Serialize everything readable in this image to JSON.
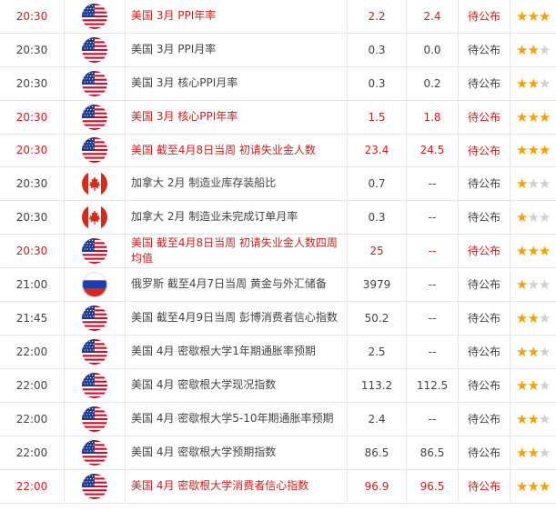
{
  "rows": [
    {
      "time": "20:30",
      "country": "US",
      "event": "美国 3月 PPI年率",
      "prev": "2.2",
      "forecast": "2.4",
      "actual": "待公布",
      "stars": 3,
      "highlight": true
    },
    {
      "time": "20:30",
      "country": "US",
      "event": "美国 3月 PPI月率",
      "prev": "0.3",
      "forecast": "0.0",
      "actual": "待公布",
      "stars": 2,
      "highlight": false
    },
    {
      "time": "20:30",
      "country": "US",
      "event": "美国 3月 核心PPI月率",
      "prev": "0.3",
      "forecast": "0.2",
      "actual": "待公布",
      "stars": 2,
      "highlight": false
    },
    {
      "time": "20:30",
      "country": "US",
      "event": "美国 3月 核心PPI年率",
      "prev": "1.5",
      "forecast": "1.8",
      "actual": "待公布",
      "stars": 3,
      "highlight": true
    },
    {
      "time": "20:30",
      "country": "US",
      "event": "美国 截至4月8日当周 初请失业金人数",
      "prev": "23.4",
      "forecast": "24.5",
      "actual": "待公布",
      "stars": 3,
      "highlight": true
    },
    {
      "time": "20:30",
      "country": "CA",
      "event": "加拿大 2月 制造业库存装船比",
      "prev": "0.7",
      "forecast": "--",
      "actual": "待公布",
      "stars": 1,
      "highlight": false
    },
    {
      "time": "20:30",
      "country": "CA",
      "event": "加拿大 2月 制造业未完成订单月率",
      "prev": "0.3",
      "forecast": "--",
      "actual": "待公布",
      "stars": 1,
      "highlight": false
    },
    {
      "time": "20:30",
      "country": "US",
      "event": "美国 截至4月8日当周 初请失业金人数四周均值",
      "prev": "25",
      "forecast": "--",
      "actual": "待公布",
      "stars": 3,
      "highlight": true
    },
    {
      "time": "21:00",
      "country": "RU",
      "event": "俄罗斯 截至4月7日当周 黄金与外汇储备",
      "prev": "3979",
      "forecast": "--",
      "actual": "待公布",
      "stars": 1,
      "highlight": false
    },
    {
      "time": "21:45",
      "country": "US",
      "event": "美国 截至4月9日当周 彭博消费者信心指数",
      "prev": "50.2",
      "forecast": "--",
      "actual": "待公布",
      "stars": 2,
      "highlight": false
    },
    {
      "time": "22:00",
      "country": "US",
      "event": "美国 4月 密歇根大学1年期通胀率预期",
      "prev": "2.5",
      "forecast": "--",
      "actual": "待公布",
      "stars": 2,
      "highlight": false
    },
    {
      "time": "22:00",
      "country": "US",
      "event": "美国 4月 密歇根大学现况指数",
      "prev": "113.2",
      "forecast": "112.5",
      "actual": "待公布",
      "stars": 2,
      "highlight": false
    },
    {
      "time": "22:00",
      "country": "US",
      "event": "美国 4月 密歇根大学5-10年期通胀率预期",
      "prev": "2.4",
      "forecast": "--",
      "actual": "待公布",
      "stars": 2,
      "highlight": false
    },
    {
      "time": "22:00",
      "country": "US",
      "event": "美国 4月 密歇根大学预期指数",
      "prev": "86.5",
      "forecast": "86.5",
      "actual": "待公布",
      "stars": 2,
      "highlight": false
    },
    {
      "time": "22:00",
      "country": "US",
      "event": "美国 4月 密歇根大学消费者信心指数",
      "prev": "96.9",
      "forecast": "96.5",
      "actual": "待公布",
      "stars": 3,
      "highlight": true
    }
  ],
  "colors": {
    "highlight": "#cc1f1f",
    "normal": "#444444",
    "star_on": "#f4a100",
    "star_off": "#d0d0d0"
  }
}
